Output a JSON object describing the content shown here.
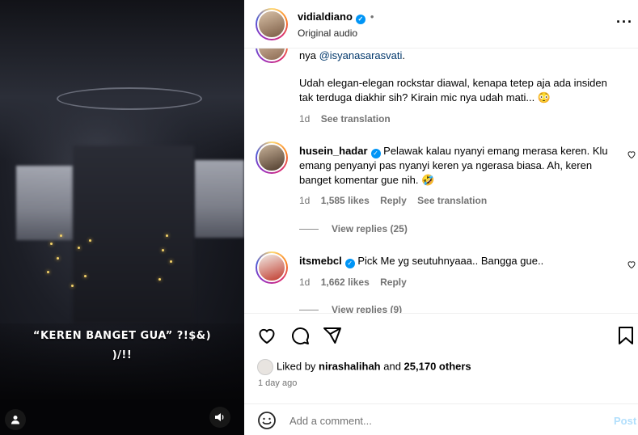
{
  "video": {
    "caption_line1": "“KEREN BANGET GUA” ?!$&)",
    "caption_line2": ")/!!"
  },
  "header": {
    "owner_username": "vidialdiano",
    "verified_mark": "✓",
    "separator": "•",
    "audio_label": "Original audio",
    "more_label": "···"
  },
  "comments": [
    {
      "mention_prefix": "nya ",
      "mention": "@isyanasarasvati",
      "mention_suffix": ".",
      "text_line2": "Udah elegan-elegan rockstar diawal, kenapa tetep aja ada insiden tak terduga diakhir sih? Kirain mic nya udah mati... 😳",
      "time": "1d",
      "see_translation": "See translation"
    },
    {
      "username": "husein_hadar",
      "text": "Pelawak kalau nyanyi emang merasa keren. Klu emang penyanyi pas nyanyi keren ya ngerasa biasa. Ah, keren banget komentar gue nih. 🤣",
      "time": "1d",
      "likes": "1,585 likes",
      "reply": "Reply",
      "see_translation": "See translation",
      "view_replies": "View replies (25)"
    },
    {
      "username": "itsmebcl",
      "text": "Pick Me yg seutuhnyaaa.. Bangga gue..",
      "time": "1d",
      "likes": "1,662 likes",
      "reply": "Reply",
      "view_replies": "View replies (9)"
    }
  ],
  "actions": {
    "liked_prefix": "Liked by ",
    "liked_user": "nirashalihah",
    "liked_and": " and ",
    "liked_count": "25,170 others",
    "date": "1 day ago"
  },
  "add_comment": {
    "placeholder": "Add a comment...",
    "post_label": "Post"
  },
  "colors": {
    "accent": "#0095f6",
    "link": "#00376b",
    "muted": "#737373",
    "post_disabled": "#b2dffc"
  },
  "icons": [
    "user-icon",
    "speaker-icon",
    "more-icon",
    "heart-icon",
    "comment-icon",
    "share-icon",
    "bookmark-icon",
    "emoji-icon",
    "verified-badge-icon"
  ]
}
